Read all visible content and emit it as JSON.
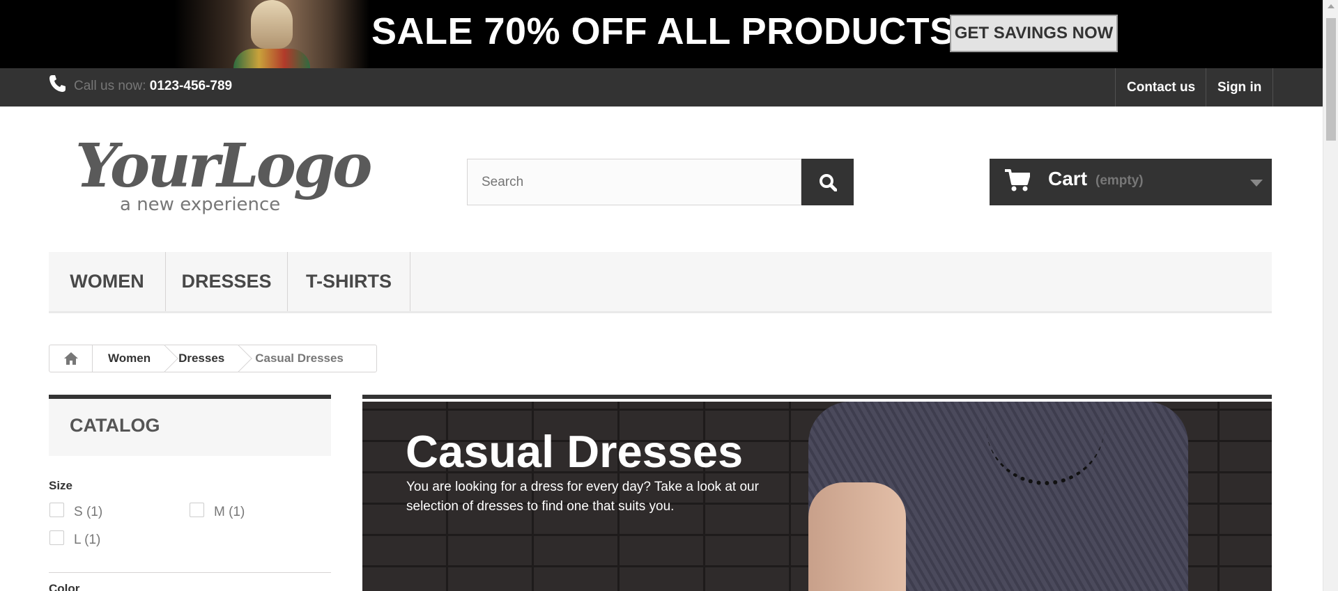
{
  "promo": {
    "headline": "SALE 70% OFF ALL PRODUCTS",
    "button_label": "GET SAVINGS NOW"
  },
  "topbar": {
    "call_prefix": "Call us now:",
    "phone": "0123-456-789",
    "contact_label": "Contact us",
    "signin_label": "Sign in",
    "phone_icon": "phone-icon"
  },
  "header": {
    "logo_main": "YourLogo",
    "logo_tagline": "a new experience",
    "search_placeholder": "Search",
    "cart_label": "Cart",
    "cart_status": "(empty)"
  },
  "menu": {
    "items": [
      "Women",
      "Dresses",
      "T-shirts"
    ]
  },
  "breadcrumb": {
    "items": [
      "Women",
      "Dresses"
    ],
    "current": "Casual Dresses"
  },
  "sidebar": {
    "title": "CATALOG",
    "size_label": "Size",
    "sizes": [
      "S (1)",
      "M (1)",
      "L (1)"
    ],
    "color_label": "Color"
  },
  "category": {
    "title": "Casual Dresses",
    "description": "You are looking for a dress for every day? Take a look at our selection of dresses to find one that suits you."
  },
  "colors": {
    "dark": "#333333",
    "light_gray": "#f6f6f6",
    "border": "#d6d4d4"
  }
}
